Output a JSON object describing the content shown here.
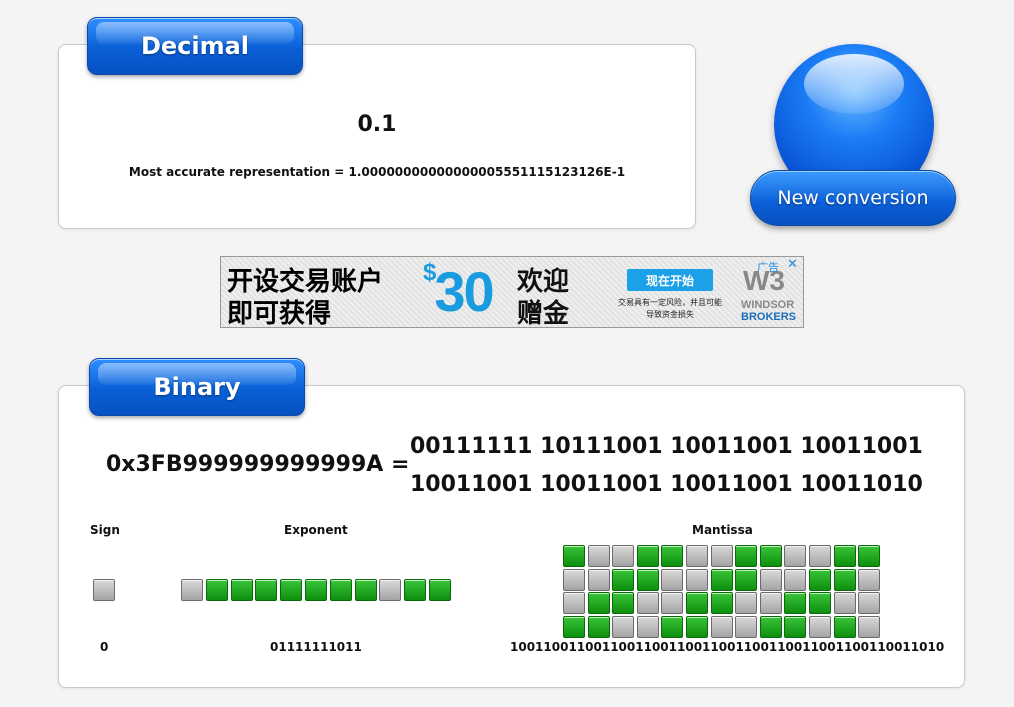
{
  "decimal": {
    "tab_label": "Decimal",
    "value": "0.1",
    "accurate": "Most accurate representation = 1.00000000000000005551115123126E-1"
  },
  "new_conversion": {
    "label": "New conversion"
  },
  "ad": {
    "line1": "开设交易账户",
    "line2": "即可获得",
    "currency": "$",
    "amount": "30",
    "bonus_line1": "欢迎",
    "bonus_line2": "赠金",
    "cta": "现在开始",
    "risk_line1": "交易具有一定风险，并且可能",
    "risk_line2": "导致资金损失",
    "logo_mark": "W3",
    "logo_line1": "WINDSOR",
    "logo_line2": "BROKERS",
    "tag": "广告",
    "close": "✕"
  },
  "binary": {
    "tab_label": "Binary",
    "hex": "0x3FB999999999999A =",
    "bin_line1": "00111111 10111001 10011001 10011001",
    "bin_line2": "10011001 10011001 10011001 10011010",
    "sign_label": "Sign",
    "exponent_label": "Exponent",
    "mantissa_label": "Mantissa",
    "sign_bits": "0",
    "exponent_bits": "01111111011",
    "mantissa_bits": "1001100110011001100110011001100110011001100110011010"
  },
  "colors": {
    "bit_on": "#1aa81a",
    "bit_off": "#b5b5b5",
    "accent": "#0a5fd6"
  }
}
